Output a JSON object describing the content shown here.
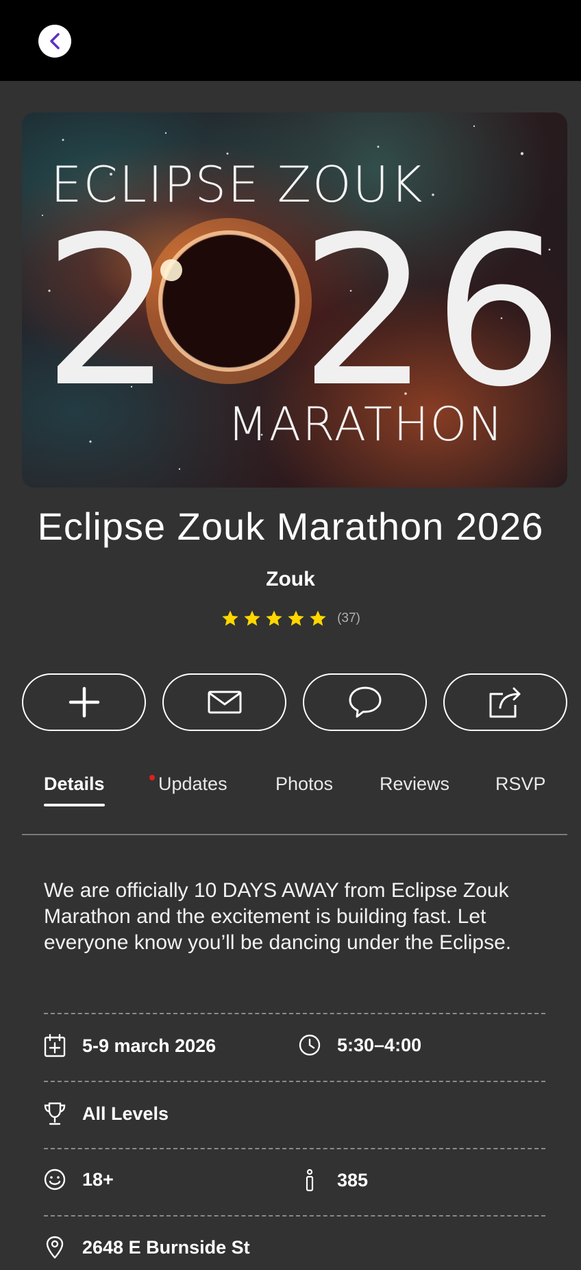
{
  "header": {
    "back_icon": "chevron-left-icon",
    "accent": "#5b2fc9"
  },
  "hero": {
    "line1": "ECLIPSE ZOUK",
    "year_digits": [
      "2",
      "2",
      "6"
    ],
    "line3": "MARATHON"
  },
  "event": {
    "title": "Eclipse Zouk Marathon 2026",
    "category": "Zouk",
    "rating": {
      "stars": 5,
      "count": "(37)",
      "star_color": "#ffd600"
    }
  },
  "actions": [
    {
      "icon": "plus-icon"
    },
    {
      "icon": "mail-icon"
    },
    {
      "icon": "chat-bubble-icon"
    },
    {
      "icon": "share-icon"
    }
  ],
  "tabs": {
    "items": [
      {
        "label": "Details",
        "active": true
      },
      {
        "label": "Updates",
        "active": false,
        "has_dot": true
      },
      {
        "label": "Photos",
        "active": false
      },
      {
        "label": "Reviews",
        "active": false
      },
      {
        "label": "RSVP",
        "active": false
      }
    ],
    "dot_color": "#e0201d"
  },
  "details": {
    "description": "We are officially 10 DAYS AWAY from Eclipse Zouk Marathon and the excitement is building fast. Let everyone know you’ll be dancing under the Eclipse.",
    "date": "5-9 march 2026",
    "time": "5:30–4:00",
    "level": "All Levels",
    "age": "18+",
    "attendees": "385",
    "address": "2648 E Burnside St"
  }
}
